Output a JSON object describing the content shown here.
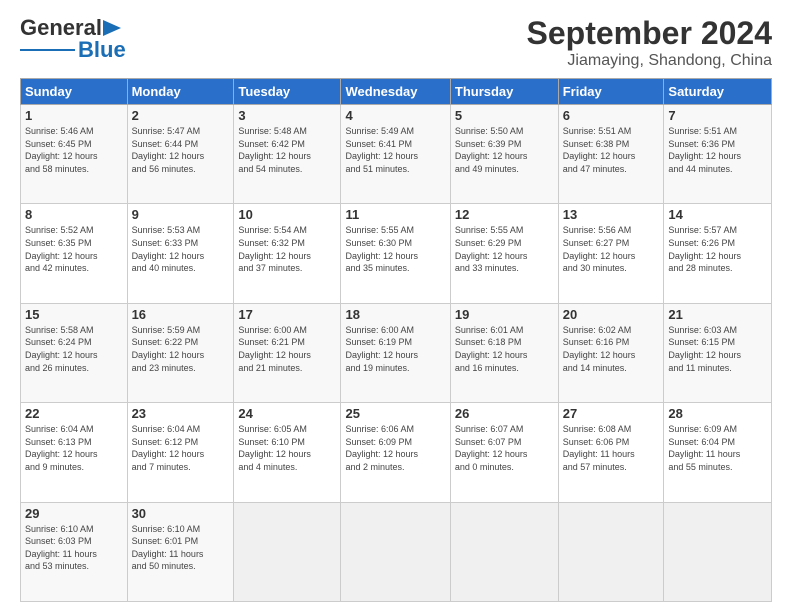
{
  "header": {
    "logo_line1": "General",
    "logo_line2": "Blue",
    "month": "September 2024",
    "location": "Jiamaying, Shandong, China"
  },
  "weekdays": [
    "Sunday",
    "Monday",
    "Tuesday",
    "Wednesday",
    "Thursday",
    "Friday",
    "Saturday"
  ],
  "weeks": [
    [
      {
        "day": "1",
        "info": "Sunrise: 5:46 AM\nSunset: 6:45 PM\nDaylight: 12 hours\nand 58 minutes."
      },
      {
        "day": "2",
        "info": "Sunrise: 5:47 AM\nSunset: 6:44 PM\nDaylight: 12 hours\nand 56 minutes."
      },
      {
        "day": "3",
        "info": "Sunrise: 5:48 AM\nSunset: 6:42 PM\nDaylight: 12 hours\nand 54 minutes."
      },
      {
        "day": "4",
        "info": "Sunrise: 5:49 AM\nSunset: 6:41 PM\nDaylight: 12 hours\nand 51 minutes."
      },
      {
        "day": "5",
        "info": "Sunrise: 5:50 AM\nSunset: 6:39 PM\nDaylight: 12 hours\nand 49 minutes."
      },
      {
        "day": "6",
        "info": "Sunrise: 5:51 AM\nSunset: 6:38 PM\nDaylight: 12 hours\nand 47 minutes."
      },
      {
        "day": "7",
        "info": "Sunrise: 5:51 AM\nSunset: 6:36 PM\nDaylight: 12 hours\nand 44 minutes."
      }
    ],
    [
      {
        "day": "8",
        "info": "Sunrise: 5:52 AM\nSunset: 6:35 PM\nDaylight: 12 hours\nand 42 minutes."
      },
      {
        "day": "9",
        "info": "Sunrise: 5:53 AM\nSunset: 6:33 PM\nDaylight: 12 hours\nand 40 minutes."
      },
      {
        "day": "10",
        "info": "Sunrise: 5:54 AM\nSunset: 6:32 PM\nDaylight: 12 hours\nand 37 minutes."
      },
      {
        "day": "11",
        "info": "Sunrise: 5:55 AM\nSunset: 6:30 PM\nDaylight: 12 hours\nand 35 minutes."
      },
      {
        "day": "12",
        "info": "Sunrise: 5:55 AM\nSunset: 6:29 PM\nDaylight: 12 hours\nand 33 minutes."
      },
      {
        "day": "13",
        "info": "Sunrise: 5:56 AM\nSunset: 6:27 PM\nDaylight: 12 hours\nand 30 minutes."
      },
      {
        "day": "14",
        "info": "Sunrise: 5:57 AM\nSunset: 6:26 PM\nDaylight: 12 hours\nand 28 minutes."
      }
    ],
    [
      {
        "day": "15",
        "info": "Sunrise: 5:58 AM\nSunset: 6:24 PM\nDaylight: 12 hours\nand 26 minutes."
      },
      {
        "day": "16",
        "info": "Sunrise: 5:59 AM\nSunset: 6:22 PM\nDaylight: 12 hours\nand 23 minutes."
      },
      {
        "day": "17",
        "info": "Sunrise: 6:00 AM\nSunset: 6:21 PM\nDaylight: 12 hours\nand 21 minutes."
      },
      {
        "day": "18",
        "info": "Sunrise: 6:00 AM\nSunset: 6:19 PM\nDaylight: 12 hours\nand 19 minutes."
      },
      {
        "day": "19",
        "info": "Sunrise: 6:01 AM\nSunset: 6:18 PM\nDaylight: 12 hours\nand 16 minutes."
      },
      {
        "day": "20",
        "info": "Sunrise: 6:02 AM\nSunset: 6:16 PM\nDaylight: 12 hours\nand 14 minutes."
      },
      {
        "day": "21",
        "info": "Sunrise: 6:03 AM\nSunset: 6:15 PM\nDaylight: 12 hours\nand 11 minutes."
      }
    ],
    [
      {
        "day": "22",
        "info": "Sunrise: 6:04 AM\nSunset: 6:13 PM\nDaylight: 12 hours\nand 9 minutes."
      },
      {
        "day": "23",
        "info": "Sunrise: 6:04 AM\nSunset: 6:12 PM\nDaylight: 12 hours\nand 7 minutes."
      },
      {
        "day": "24",
        "info": "Sunrise: 6:05 AM\nSunset: 6:10 PM\nDaylight: 12 hours\nand 4 minutes."
      },
      {
        "day": "25",
        "info": "Sunrise: 6:06 AM\nSunset: 6:09 PM\nDaylight: 12 hours\nand 2 minutes."
      },
      {
        "day": "26",
        "info": "Sunrise: 6:07 AM\nSunset: 6:07 PM\nDaylight: 12 hours\nand 0 minutes."
      },
      {
        "day": "27",
        "info": "Sunrise: 6:08 AM\nSunset: 6:06 PM\nDaylight: 11 hours\nand 57 minutes."
      },
      {
        "day": "28",
        "info": "Sunrise: 6:09 AM\nSunset: 6:04 PM\nDaylight: 11 hours\nand 55 minutes."
      }
    ],
    [
      {
        "day": "29",
        "info": "Sunrise: 6:10 AM\nSunset: 6:03 PM\nDaylight: 11 hours\nand 53 minutes."
      },
      {
        "day": "30",
        "info": "Sunrise: 6:10 AM\nSunset: 6:01 PM\nDaylight: 11 hours\nand 50 minutes."
      },
      {
        "day": "",
        "info": ""
      },
      {
        "day": "",
        "info": ""
      },
      {
        "day": "",
        "info": ""
      },
      {
        "day": "",
        "info": ""
      },
      {
        "day": "",
        "info": ""
      }
    ]
  ]
}
